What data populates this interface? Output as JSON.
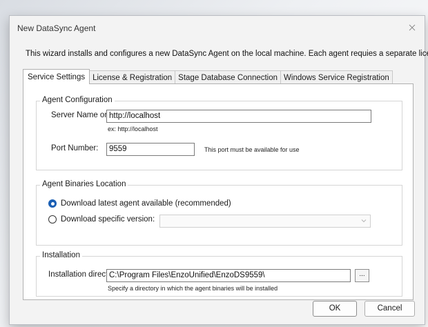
{
  "dialog": {
    "title": "New DataSync Agent",
    "intro": "This wizard installs and configures a new DataSync Agent on the local machine. Each agent requies a separate license."
  },
  "tabs": [
    {
      "label": "Service Settings",
      "active": true
    },
    {
      "label": "License & Registration",
      "active": false
    },
    {
      "label": "Stage Database Connection",
      "active": false
    },
    {
      "label": "Windows Service Registration",
      "active": false
    }
  ],
  "agent_config": {
    "legend": "Agent Configuration",
    "server_label": "Server Name or IP:",
    "server_value": "http://localhost",
    "server_hint": "ex:  http://localhost",
    "port_label": "Port Number:",
    "port_value": "9559",
    "port_hint": "This port must be available for use"
  },
  "binaries": {
    "legend": "Agent Binaries Location",
    "option_latest": "Download latest agent available (recommended)",
    "option_specific": "Download specific version:",
    "selected": "latest",
    "version_value": ""
  },
  "installation": {
    "legend": "Installation",
    "dir_label": "Installation directory:",
    "dir_value": "C:\\Program Files\\EnzoUnified\\EnzoDS9559\\",
    "browse_label": "...",
    "dir_hint": "Specify a directory in which the agent binaries will be installed"
  },
  "buttons": {
    "ok": "OK",
    "cancel": "Cancel"
  },
  "icons": {
    "close": "close-icon",
    "dropdown": "chevron-down-icon"
  },
  "colors": {
    "accent": "#1a5fb4",
    "dialog_bg": "#f3f3f3",
    "panel_bg": "#ffffff"
  }
}
